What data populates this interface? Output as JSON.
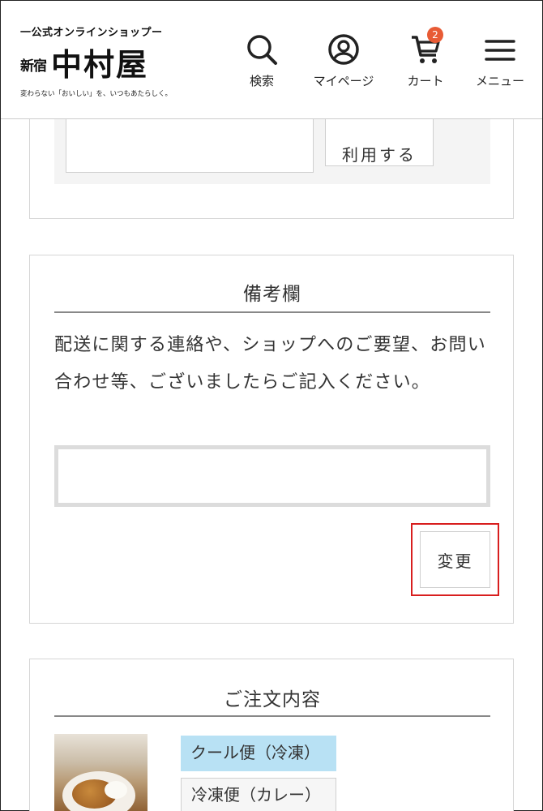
{
  "header": {
    "logo_top": "一公式オンラインショップー",
    "logo_shinjuku": "新宿",
    "logo_name": "中村屋",
    "logo_tagline": "変わらない「おいしい」を、いつもあたらしく。",
    "nav": [
      {
        "label": "検索",
        "icon": "search-icon"
      },
      {
        "label": "マイページ",
        "icon": "user-icon"
      },
      {
        "label": "カート",
        "icon": "cart-icon",
        "badge": "2"
      },
      {
        "label": "メニュー",
        "icon": "hamburger-icon"
      }
    ]
  },
  "coupon": {
    "apply_label": "利用する"
  },
  "remarks": {
    "title": "備考欄",
    "description": "配送に関する連絡や、ショップへのご要望、お問い合わせ等、ございましたらご記入ください。",
    "textarea_value": "",
    "change_label": "変更"
  },
  "order": {
    "title": "ご注文内容",
    "shipping_tag": "クール便（冷凍）",
    "category_tag": "冷凍便（カレー）"
  },
  "colors": {
    "badge": "#e85b35",
    "highlight_border": "#d81e1e",
    "cool_tag_bg": "#b8e1f4"
  }
}
